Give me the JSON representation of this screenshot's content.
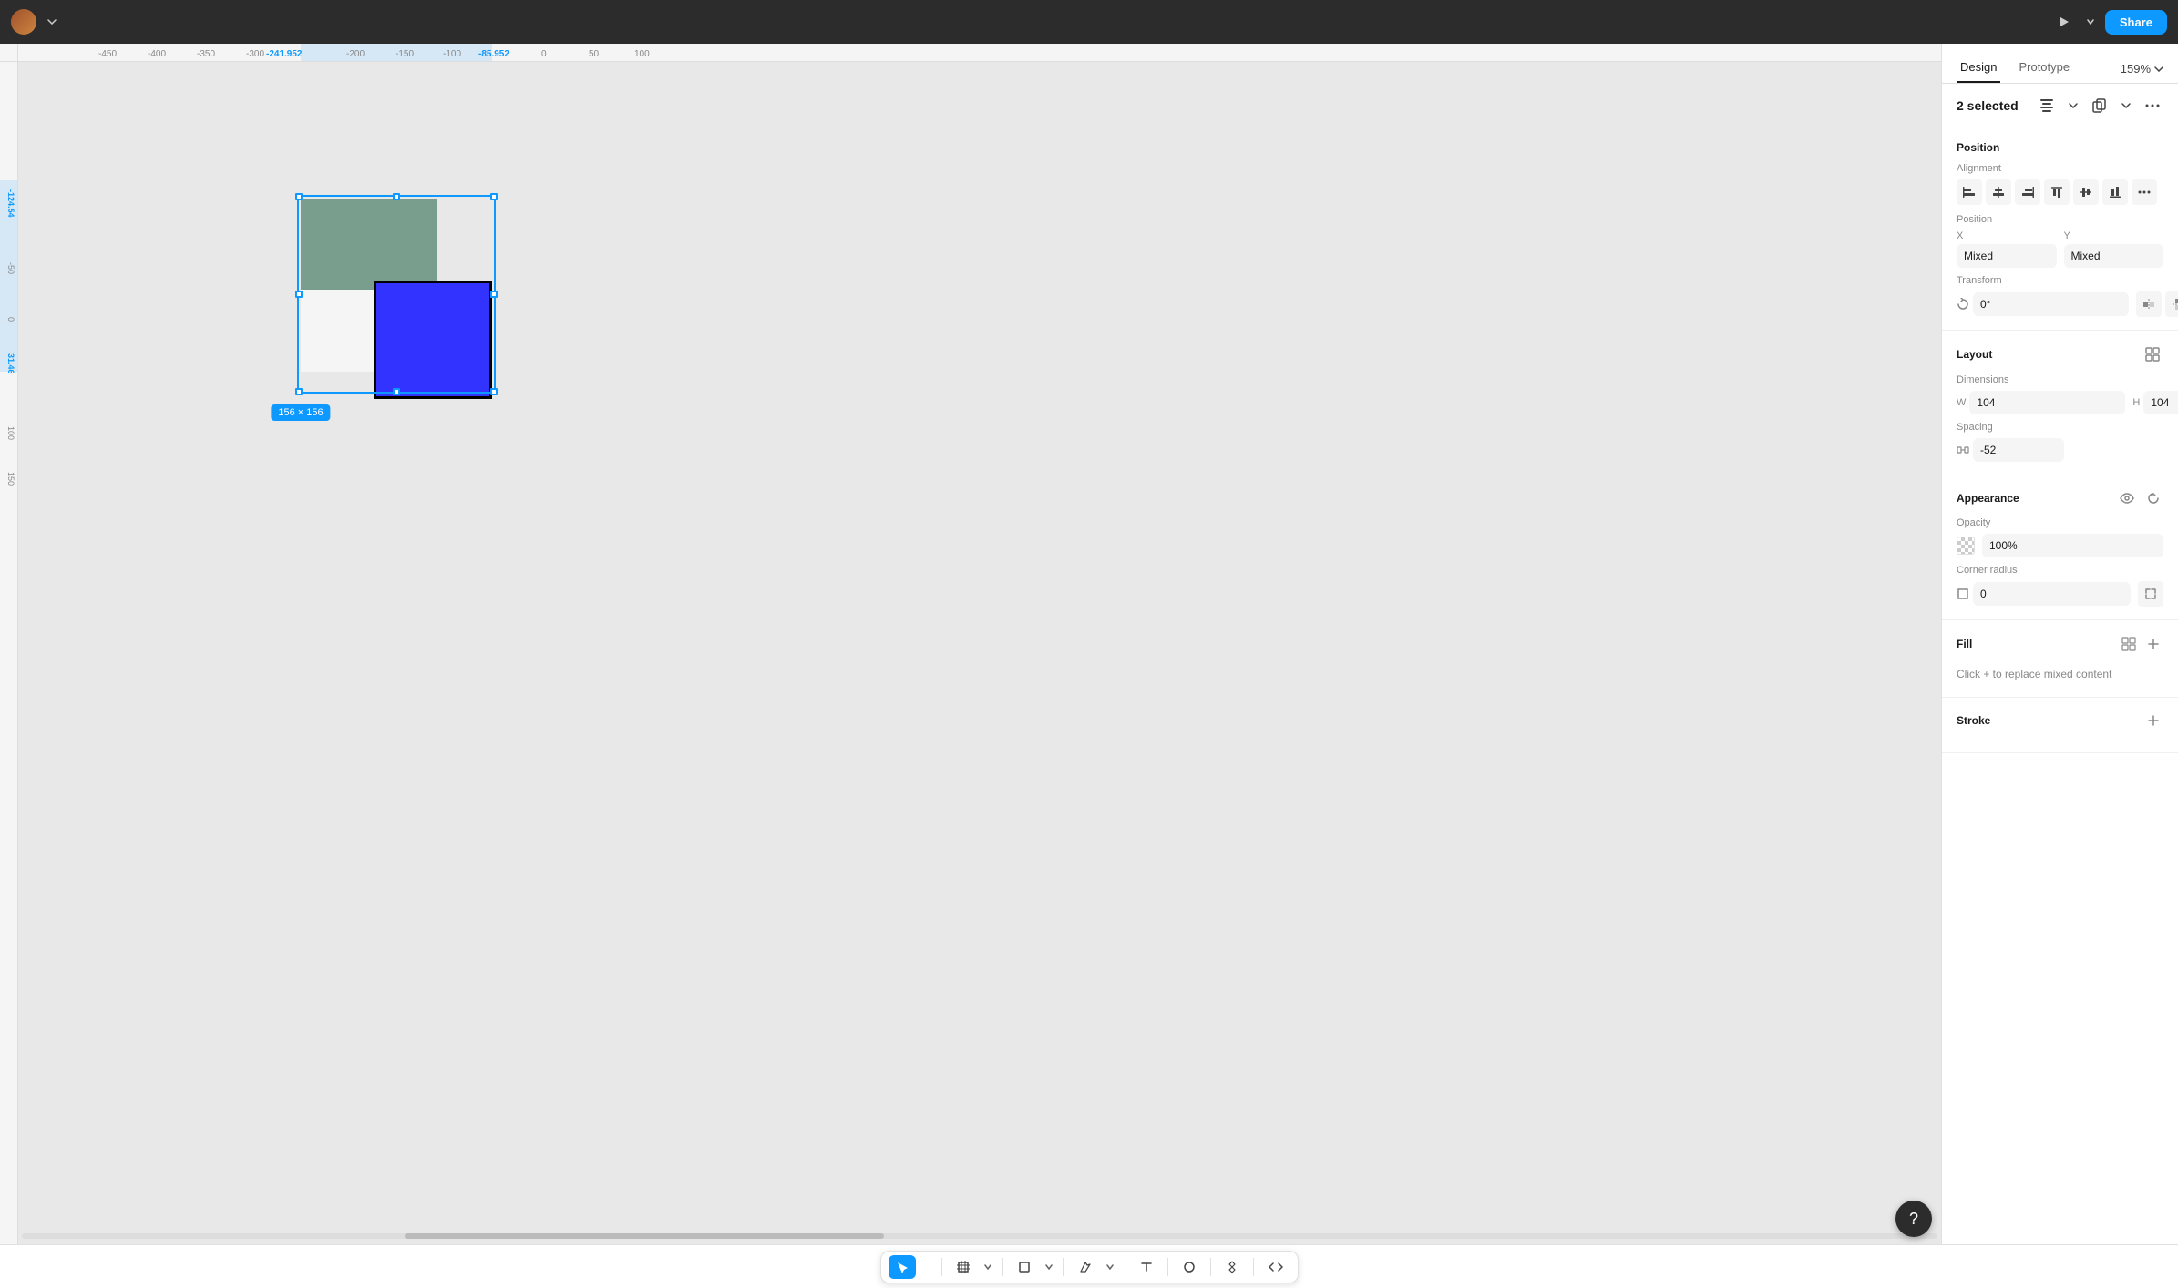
{
  "topbar": {
    "play_label": "▶",
    "share_label": "Share",
    "zoom_label": "159%"
  },
  "panel": {
    "design_tab": "Design",
    "prototype_tab": "Prototype",
    "selected_count": "2 selected",
    "zoom": "159%",
    "position_section": "Position",
    "alignment_label": "Alignment",
    "position_label": "Position",
    "x_label": "X",
    "x_value": "Mixed",
    "y_label": "Y",
    "y_value": "Mixed",
    "transform_label": "Transform",
    "rotation_value": "0°",
    "layout_label": "Layout",
    "dimensions_label": "Dimensions",
    "w_label": "W",
    "w_value": "104",
    "h_label": "H",
    "h_value": "104",
    "spacing_label": "Spacing",
    "spacing_value": "-52",
    "appearance_label": "Appearance",
    "opacity_label": "Opacity",
    "opacity_value": "100%",
    "corner_label": "Corner radius",
    "corner_value": "0",
    "fill_label": "Fill",
    "fill_mixed": "Click + to replace mixed content",
    "stroke_label": "Stroke"
  },
  "canvas": {
    "ruler_ticks_top": [
      "-450",
      "-400",
      "-350",
      "-300",
      "-241.952",
      "-200",
      "-150",
      "-100",
      "-85.952",
      "0",
      "50",
      "100"
    ],
    "ruler_labels_left": [
      "-124.54",
      "-50",
      "0",
      "31.46",
      "100",
      "150"
    ],
    "size_tooltip": "156 × 156",
    "coord_left": "-124.54",
    "coord_left2": "31.46"
  },
  "toolbar": {
    "select_label": "▶",
    "frame_label": "#",
    "rect_label": "□",
    "pen_label": "✒",
    "text_label": "T",
    "ellipse_label": "○",
    "component_label": "⧓",
    "code_label": "</>",
    "active_tool": "select"
  }
}
